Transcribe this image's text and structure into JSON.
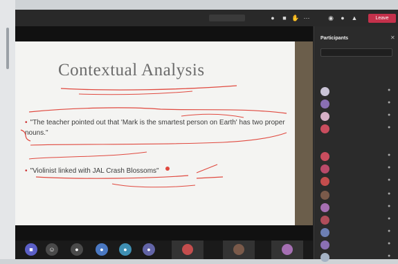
{
  "window": {
    "timer": "",
    "leave_label": "Leave"
  },
  "slide": {
    "title": "Contextual Analysis",
    "bullets": [
      "\"The teacher pointed out that 'Mark is the smartest person on Earth' has two proper nouns.\"",
      "\"Violinist linked with JAL Crash Blossoms\""
    ]
  },
  "stage": {
    "presenter_label": ""
  },
  "panel": {
    "title": "Participants",
    "search_placeholder": "",
    "presenters_label": "",
    "attendees_label": "",
    "participants": [
      {
        "name": "",
        "sub": "",
        "color": "#c9c3d6"
      },
      {
        "name": "",
        "sub": "",
        "color": "#8a6fb3"
      },
      {
        "name": "",
        "sub": "",
        "color": "#d6b0c6"
      },
      {
        "name": "",
        "sub": "",
        "color": "#c94d5e"
      },
      {
        "name": "",
        "sub": "",
        "color": "#c94d5e"
      },
      {
        "name": "",
        "sub": "",
        "color": "#b94a6a"
      },
      {
        "name": "",
        "sub": "",
        "color": "#c44d4d"
      },
      {
        "name": "",
        "sub": "",
        "color": "#7a5a4a"
      },
      {
        "name": "",
        "sub": "",
        "color": "#a56fb3"
      },
      {
        "name": "",
        "sub": "",
        "color": "#b04d5a"
      },
      {
        "name": "",
        "sub": "",
        "color": "#6d7fb3"
      },
      {
        "name": "",
        "sub": "",
        "color": "#8a6fb3"
      },
      {
        "name": "",
        "sub": "",
        "color": "#a5b3c4"
      }
    ]
  },
  "colors": {
    "accent": "#6264a7",
    "leave": "#c4314b",
    "ink": "#e0483e"
  },
  "icons": [
    "chat-icon",
    "reactions-icon",
    "participants-icon",
    "more-icon",
    "camera-icon",
    "mic-icon",
    "share-icon",
    "video-icon",
    "raise-hand-icon",
    "people-icon"
  ]
}
